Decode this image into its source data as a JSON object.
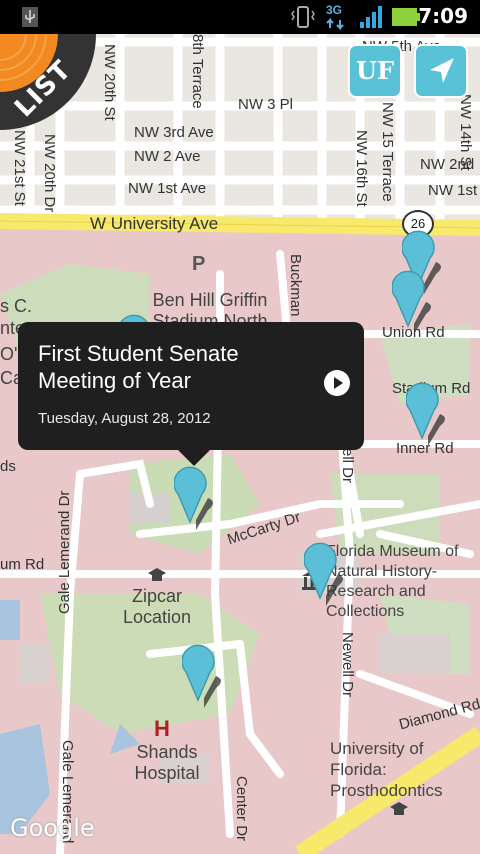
{
  "status_bar": {
    "network": "3G",
    "time": "7:09"
  },
  "map": {
    "streets": {
      "nw5th": "NW 5th Ave",
      "nw20st": "NW 20th St",
      "nw8terr": "8th Terrace",
      "nw3pl": "NW 3 Pl",
      "nw15terr": "NW 15 Terrace",
      "nw14st": "NW 14th St",
      "nw3rd": "NW 3rd Ave",
      "nw2": "NW 2 Ave",
      "nw2nd": "NW 2nd",
      "nw1st": "NW 1st Ave",
      "nw1st_right": "NW 1st",
      "nw21st": "NW 21st St",
      "nw20dr": "NW 20th Dr",
      "nw16st": "NW 16th St",
      "univ": "W University Ave",
      "route": "26",
      "buckman": "Buckman Dr",
      "union": "Union Rd",
      "stadium": "Stadium Rd",
      "inner": "Inner Rd",
      "newell_dr": "Newell Dr",
      "mccarty": "McCarty Dr",
      "um_rd": "um Rd",
      "gale1": "Gale Lemerand Dr",
      "gale2": "Gale Lemerand",
      "newell_dr2": "Newell Dr",
      "diamond": "Diamond Rd",
      "center": "Center Dr",
      "ds": "ds"
    },
    "places": {
      "parking": "P",
      "stadium": "Ben Hill Griffin Stadium North",
      "zipcar": "Zipcar Location",
      "hospital_h": "H",
      "shands": "Shands Hospital",
      "museum": "Florida Museum of Natural History-Research and Collections",
      "prostho": "University of Florida: Prosthodontics",
      "left_cut1": "s C.",
      "left_cut2": "nter",
      "left_cut3": "O'Co",
      "left_cut4": "Ca"
    },
    "popup": {
      "title": "First Student Senate Meeting of Year",
      "date": "Tuesday, August 28, 2012"
    },
    "buttons": {
      "list": "LIST",
      "uf": "UF"
    },
    "attribution": "Google",
    "accent_color": "#59c2d6"
  }
}
